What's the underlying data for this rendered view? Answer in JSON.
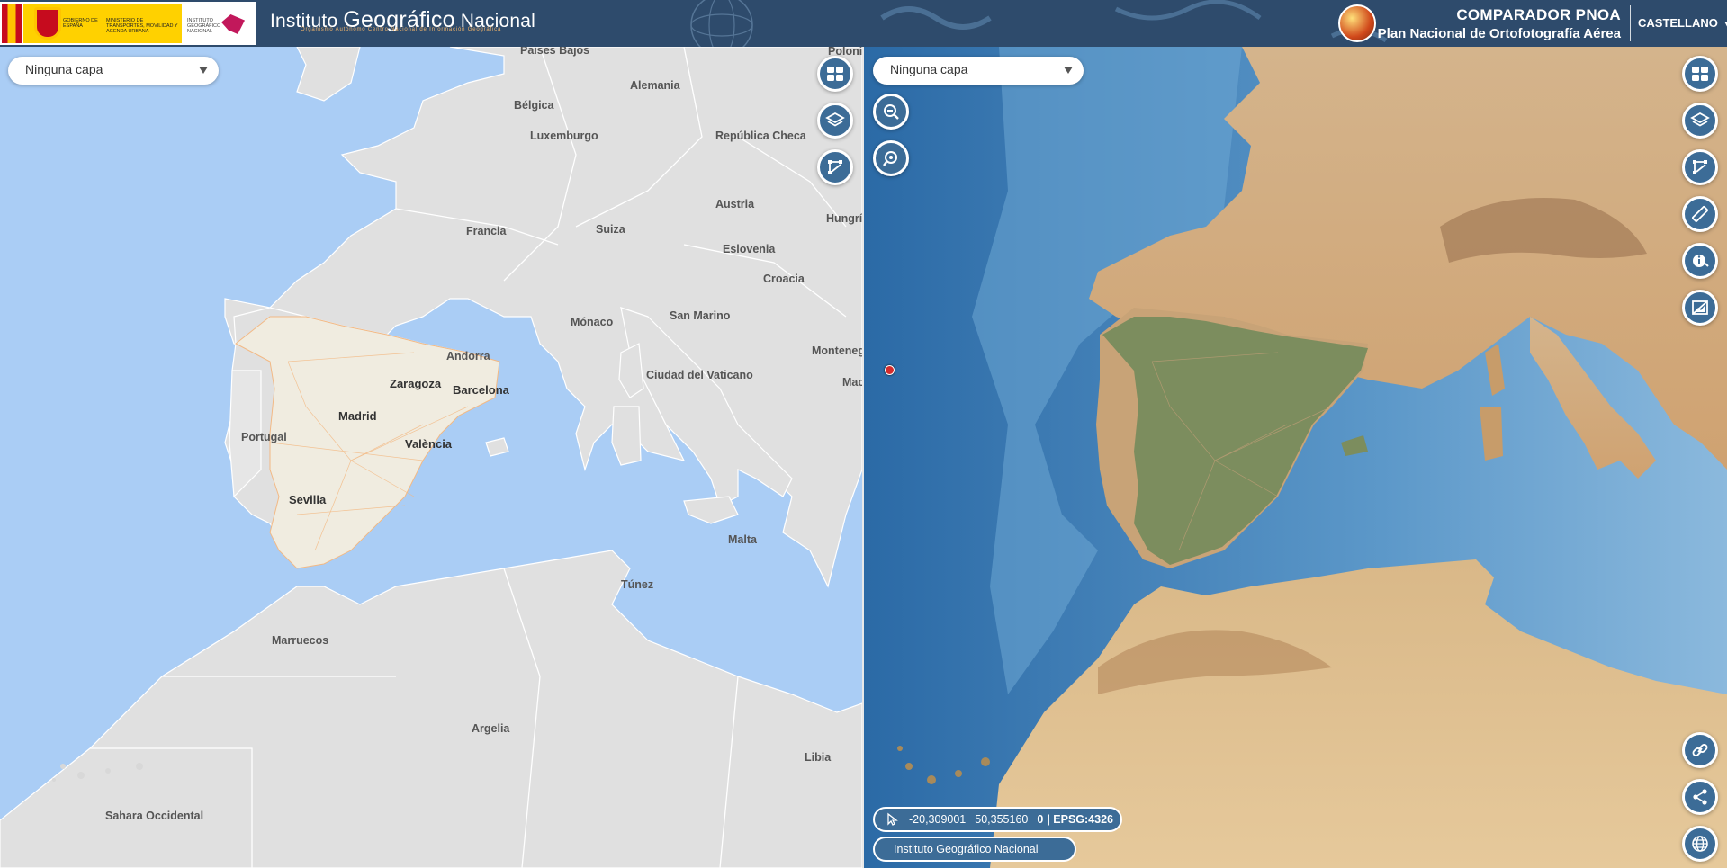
{
  "header": {
    "gov_text_1": "GOBIERNO DE ESPAÑA",
    "gov_text_2": "MINISTERIO DE TRANSPORTES, MOVILIDAD Y AGENDA URBANA",
    "gov_text_3": "INSTITUTO GEOGRÁFICO NACIONAL",
    "ign_title_prefix": "Instituto ",
    "ign_title_main": "Geográfico",
    "ign_title_suffix": " Nacional",
    "ign_subtitle": "Organismo Autónomo  Centro Nacional de Información Geográfica",
    "app_title": "COMPARADOR PNOA",
    "app_subtitle": "Plan Nacional de Ortofotografía Aérea",
    "language": "CASTELLANO"
  },
  "left_map": {
    "layer_select": "Ninguna capa",
    "labels": [
      "Países Bajos",
      "Polonia",
      "Alemania",
      "Bélgica",
      "Luxemburgo",
      "República Checa",
      "Austria",
      "Hungría",
      "Francia",
      "Suiza",
      "Eslovenia",
      "Croacia",
      "Mónaco",
      "San Marino",
      "Andorra",
      "Montenegro",
      "Zaragoza",
      "Barcelona",
      "Ciudad del Vaticano",
      "Mac",
      "Madrid",
      "Portugal",
      "València",
      "Sevilla",
      "Malta",
      "Túnez",
      "Marruecos",
      "Argelia",
      "Libia",
      "Sahara Occidental"
    ],
    "buttons": [
      "grid-layout-icon",
      "layers-icon",
      "vector-edit-icon"
    ]
  },
  "right_map": {
    "layer_select": "Ninguna capa",
    "coordinates": {
      "x": "-20,309001",
      "y": "50,355160",
      "z": "0",
      "epsg": "| EPSG:4326"
    },
    "attribution": "Instituto Geográfico Nacional",
    "buttons_top": [
      "grid-layout-icon",
      "layers-icon",
      "vector-edit-icon",
      "ruler-icon",
      "info-icon",
      "image-compare-icon"
    ],
    "buttons_left": [
      "zoom-out-icon",
      "zoom-location-icon"
    ],
    "buttons_bottom": [
      "link-icon",
      "share-icon",
      "globe-icon"
    ]
  },
  "colors": {
    "header_bg": "#2e4b6c",
    "button_bg": "#3c6c97",
    "sea_left": "#aacdf5",
    "land_left": "#e0e0e0",
    "pnoa_accent": "#f0b36a"
  }
}
